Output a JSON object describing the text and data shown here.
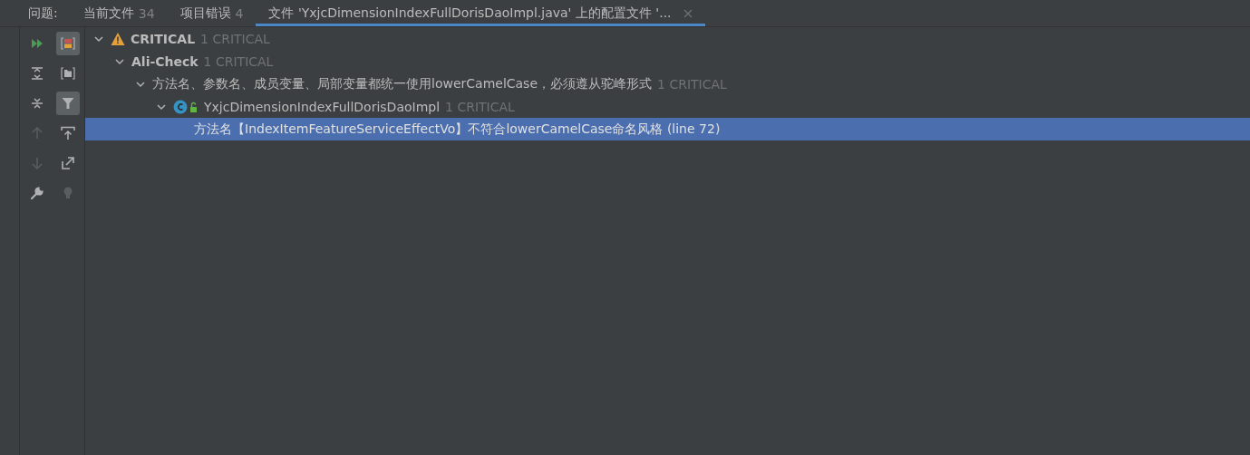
{
  "tab_bar": {
    "label": "问题:",
    "tabs": [
      {
        "label": "当前文件",
        "count": "34",
        "selected": false,
        "closable": false
      },
      {
        "label": "项目错误",
        "count": "4",
        "selected": false,
        "closable": false
      },
      {
        "label": "文件 'YxjcDimensionIndexFullDorisDaoImpl.java' 上的配置文件 '...",
        "selected": true,
        "closable": true
      }
    ]
  },
  "toolbar": [
    {
      "kind": "run",
      "toggled": false,
      "disabled": false
    },
    {
      "kind": "severity-group",
      "toggled": true,
      "disabled": false
    },
    {
      "kind": "expand-all",
      "toggled": false,
      "disabled": false
    },
    {
      "kind": "folder-group",
      "toggled": false,
      "disabled": false
    },
    {
      "kind": "collapse-all",
      "toggled": false,
      "disabled": false
    },
    {
      "kind": "filter",
      "toggled": true,
      "disabled": false
    },
    {
      "kind": "up",
      "toggled": false,
      "disabled": true
    },
    {
      "kind": "export",
      "toggled": false,
      "disabled": false
    },
    {
      "kind": "down",
      "toggled": false,
      "disabled": true
    },
    {
      "kind": "open-external",
      "toggled": false,
      "disabled": false
    },
    {
      "kind": "wrench",
      "toggled": false,
      "disabled": false
    },
    {
      "kind": "bulb",
      "toggled": false,
      "disabled": true
    }
  ],
  "tree": [
    {
      "kind": "severity",
      "label": "CRITICAL",
      "count": "1 CRITICAL",
      "expanded": true,
      "selected": false,
      "children": [
        {
          "kind": "group",
          "label": "Ali-Check",
          "count": "1 CRITICAL",
          "expanded": true,
          "selected": false,
          "children": [
            {
              "label": "方法名、参数名、成员变量、局部变量都统一使用lowerCamelCase，必须遵从驼峰形式",
              "count": "1 CRITICAL",
              "expanded": true,
              "selected": false,
              "children": [
                {
                  "kind": "class",
                  "label": "YxjcDimensionIndexFullDorisDaoImpl",
                  "count": "1 CRITICAL",
                  "expanded": true,
                  "selected": false,
                  "children": [
                    {
                      "label": "方法名【IndexItemFeatureServiceEffectVo】不符合lowerCamelCase命名风格 (line 72)",
                      "selected": true
                    }
                  ]
                }
              ]
            }
          ]
        }
      ]
    }
  ]
}
